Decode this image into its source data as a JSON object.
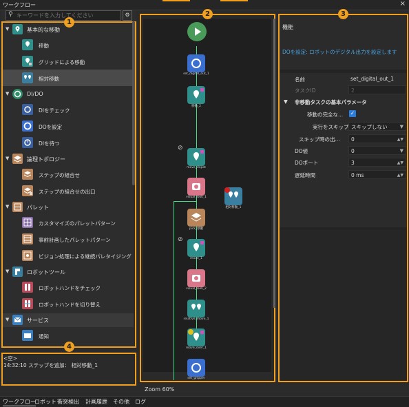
{
  "window": {
    "title": "ワークフロー",
    "close": "×"
  },
  "search": {
    "placeholder": "キーワードを入力してください"
  },
  "tree": {
    "cat_basic": "基本的な移動",
    "item_move": "移動",
    "item_grid_move": "グリッドによる移動",
    "item_relative_move": "相対移動",
    "cat_dido": "DI/DO",
    "item_check_di": "DIをチェック",
    "item_set_do": "DOを設定",
    "item_wait_di": "DIを待つ",
    "cat_logic": "論理トポロジー",
    "item_step_combo": "ステップの組合せ",
    "item_step_combo_exit": "ステップの組合せの出口",
    "cat_pallet": "パレット",
    "item_custom_pallet": "カスタマイズのパレットパターン",
    "item_preplanned_pallet": "事前計画したパレットパターン",
    "item_vision_pallet": "ビジョン処理による継続パレタイジング",
    "cat_robot_tools": "ロボットツール",
    "item_check_hand": "ロボットハンドをチェック",
    "item_switch_hand": "ロボットハンドを切り替え",
    "cat_service": "サービス",
    "item_notify": "通知"
  },
  "log": {
    "line1": "<空>",
    "line2": "14:32:10 ステップを追加： 相対移動_1"
  },
  "canvas": {
    "zoom": "Zoom 60%",
    "nodes": [
      {
        "label": "set_digital_out_1"
      },
      {
        "label": "移動_2"
      },
      {
        "label": "move_depot"
      },
      {
        "label": "visual_look_1"
      },
      {
        "label": "相対移動_1"
      },
      {
        "label": "pick_移動"
      },
      {
        "label": "move_1"
      },
      {
        "label": "visual_look_2"
      },
      {
        "label": "relative_move_1"
      },
      {
        "label": "move_over_1"
      },
      {
        "label": "set_gripper"
      }
    ]
  },
  "props": {
    "header": "機能",
    "description": "DOを設定: ロボットのデジタル出力を設定します",
    "name_label": "名前",
    "name_value": "set_digital_out_1",
    "taskid_label": "タスクID",
    "taskid_value": "2",
    "section_label": "非移動タスクの基本パラメータ",
    "complete_label": "移動の完全な...",
    "skip_label": "実行をスキップ",
    "skip_value": "スキップしない",
    "skip_exit_label": "スキップ時の出...",
    "skip_exit_value": "0",
    "do_value_label": "DO値",
    "do_value_value": "0",
    "do_port_label": "DOポート",
    "do_port_value": "3",
    "delay_label": "遅延時間",
    "delay_value": "0 ms"
  },
  "badges": {
    "b1": "1",
    "b2": "2",
    "b3": "3",
    "b4": "4"
  },
  "tabs": [
    "ワークフロー",
    "ロボット",
    "衝突検出",
    "計画履歴",
    "その他",
    "ログ"
  ],
  "colors": {
    "accent": "#f0a020",
    "node_teal": "#2f8f8a",
    "node_pink": "#d9768a",
    "node_blue": "#3a6fd0",
    "node_brown": "#b9855a",
    "link": "#4aa3e0"
  }
}
